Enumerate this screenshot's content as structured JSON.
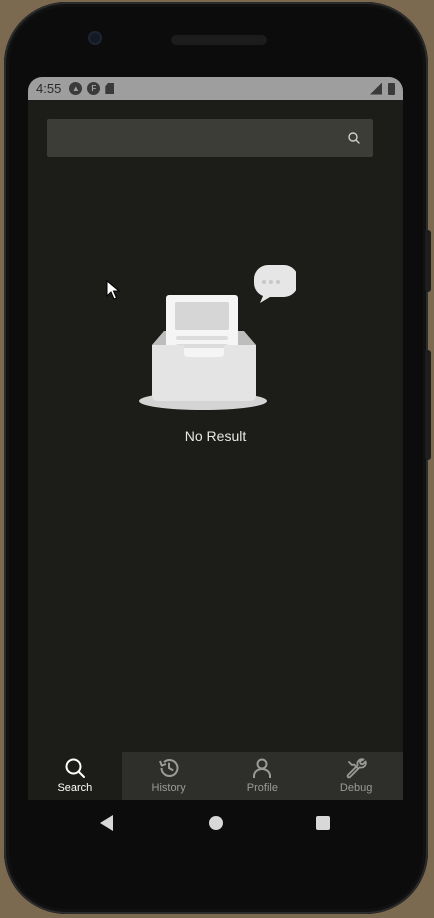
{
  "status_bar": {
    "time": "4:55",
    "icons": [
      "a-notification-icon",
      "f-notification-icon",
      "sd-card-icon",
      "signal-icon",
      "battery-icon"
    ]
  },
  "search": {
    "value": "",
    "placeholder": "",
    "icon": "search-icon"
  },
  "empty_state": {
    "text": "No Result",
    "icon": "empty-inbox-illustration"
  },
  "tabs": [
    {
      "label": "Search",
      "icon": "search-icon",
      "active": true
    },
    {
      "label": "History",
      "icon": "history-icon",
      "active": false
    },
    {
      "label": "Profile",
      "icon": "user-icon",
      "active": false
    },
    {
      "label": "Debug",
      "icon": "wrench-icon",
      "active": false
    }
  ],
  "colors": {
    "background": "#1c1c18",
    "status_bar": "#9e9e9e",
    "search_box": "#3d3d37",
    "tab_inactive_bg": "#2e2e2b",
    "tab_active_text": "#ffffff",
    "tab_inactive_text": "#9a9a96"
  }
}
